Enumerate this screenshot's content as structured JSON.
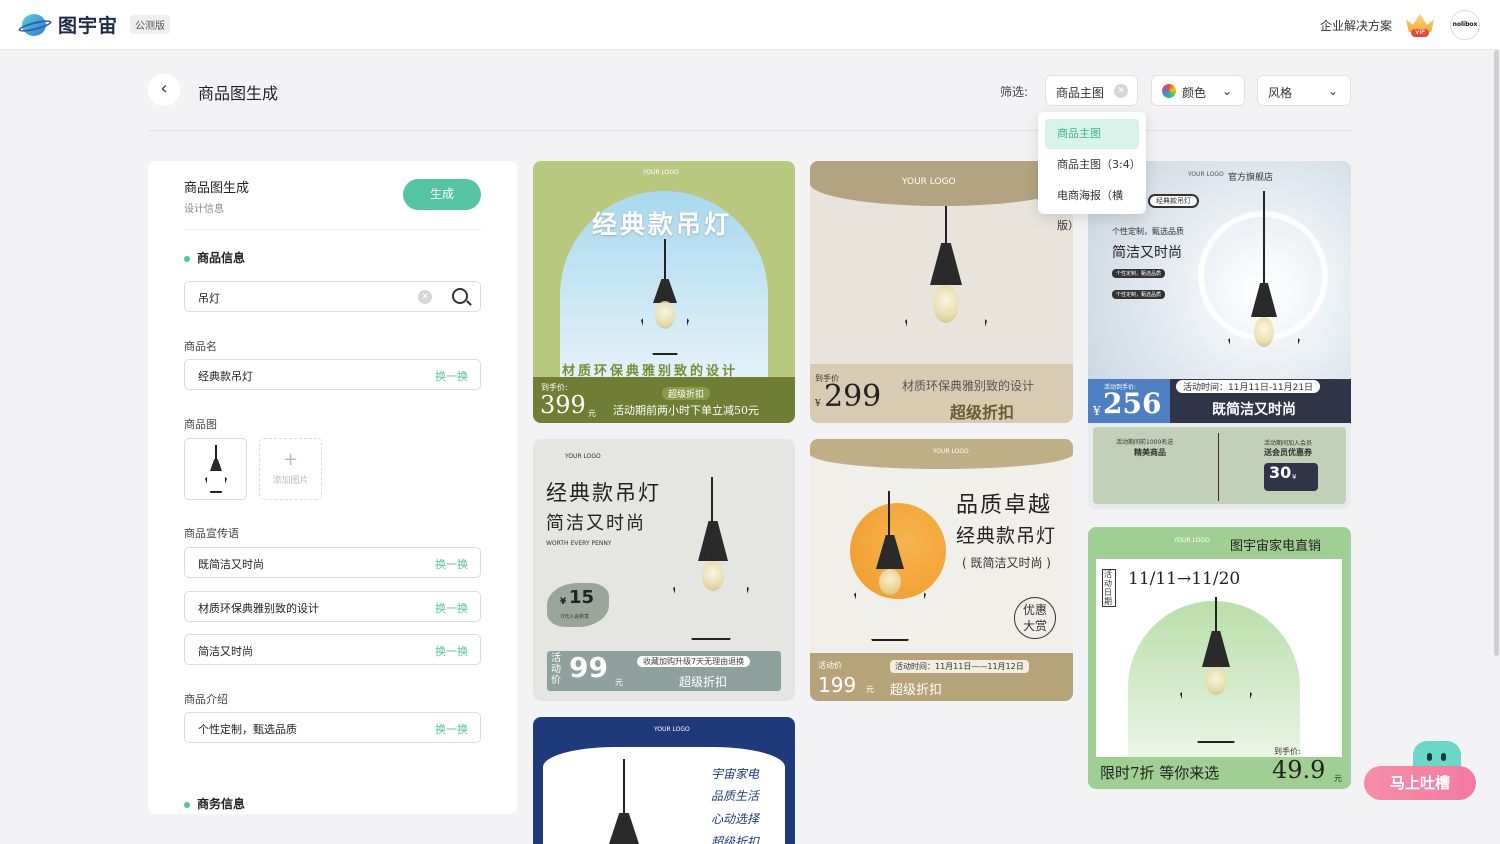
{
  "brand": {
    "name": "图宇宙",
    "badge": "公测版"
  },
  "nav": {
    "enterprise": "企业解决方案",
    "vip": "VIP",
    "avatar": "nolibox"
  },
  "header": {
    "title": "商品图生成",
    "filter_label": "筛选:"
  },
  "filters": {
    "main": "商品主图",
    "color": "颜色",
    "style": "风格",
    "options": [
      "商品主图",
      "商品主图（3:4）",
      "电商海报（横版）"
    ]
  },
  "panel": {
    "title": "商品图生成",
    "subtitle": "设计信息",
    "generate": "生成",
    "section_product": "商品信息",
    "search_value": "吊灯",
    "name_label": "商品名",
    "name_value": "经典款吊灯",
    "swap": "换一换",
    "image_label": "商品图",
    "add_image": "添加图片",
    "slogan_label": "商品宣传语",
    "slogans": [
      "既简洁又时尚",
      "材质环保典雅别致的设计",
      "简洁又时尚"
    ],
    "intro_label": "商品介绍",
    "intro_value": "个性定制，甄选品质",
    "section_business": "商务信息"
  },
  "cards": {
    "c1": {
      "logo": "YOUR LOGO",
      "title": "经典款吊灯",
      "slogan": "材质环保典雅别致的设计",
      "price_label": "到手价:",
      "price": "399",
      "unit": "元",
      "tag": "超级折扣",
      "promo": "活动期前两小时下单立减50元"
    },
    "c2": {
      "logo": "YOUR LOGO",
      "price_label": "到手价",
      "currency": "¥",
      "price": "299",
      "slogan": "材质环保典雅别致的设计",
      "tag": "超级折扣"
    },
    "c3": {
      "logo": "YOUR LOGO",
      "store": "官方旗舰店",
      "search": "经典款吊灯",
      "line1": "个性定制，甄选品质",
      "line2": "简洁又时尚",
      "chip": "个性定制，甄选品质",
      "price_label": "活动到手价:",
      "currency": "¥",
      "price": "256",
      "date": "活动时间：11月11日-11月21日",
      "slogan": "既简洁又时尚",
      "gift1a": "活动期间前1000名送",
      "gift1b": "精美商品",
      "gift2a": "活动期间加入会员",
      "gift2b": "送会员优惠券",
      "coupon": "30",
      "coupon_unit": "¥"
    },
    "c4": {
      "logo": "YOUR LOGO",
      "title1": "经典款吊灯",
      "title2": "简洁又时尚",
      "en": "WORTH EVERY PENNY",
      "currency": "¥",
      "badge_price": "15",
      "badge_sub": "0元入会新享",
      "side_label": "活动价",
      "price": "99",
      "unit": "元",
      "note": "收藏加购升级7天无理由退换",
      "tag": "超级折扣"
    },
    "c5": {
      "logo": "YOUR LOGO",
      "title1": "品质卓越",
      "title2": "经典款吊灯",
      "title3": "( 既简洁又时尚 )",
      "seal": "优惠大赏",
      "price_label": "活动价",
      "price": "199",
      "unit": "元",
      "date": "活动时间：11月11日——11月12日",
      "tag": "超级折扣"
    },
    "c6": {
      "logo": "YOUR LOGO",
      "headline": "图宇宙家电直销",
      "date_label": "活动日期",
      "date": "11/11→11/20",
      "promo": "限时7折 等你来选",
      "price_label": "到手价:",
      "price": "49.9",
      "unit": "元"
    },
    "c7": {
      "logo": "YOUR LOGO",
      "lines": [
        "宇宙家电",
        "品质生活",
        "心动选择",
        "超级折扣"
      ]
    }
  },
  "feedback": "马上吐槽"
}
